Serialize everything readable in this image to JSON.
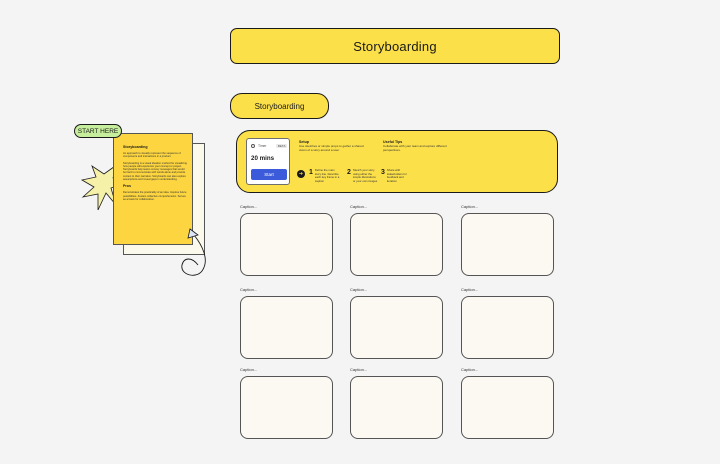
{
  "board": {
    "title": "Storyboarding",
    "section_label": "Storyboarding"
  },
  "instructions": {
    "timer": {
      "label": "Timer",
      "badge": "BETA",
      "duration": "20 mins",
      "start_label": "Start"
    },
    "setup": {
      "title": "Setup",
      "text": "Use sketches or simple props to gather a shared vision of a story around a user"
    },
    "useful_tips": {
      "title": "Useful Tips",
      "text": "Collaborate with your team and explore different perspectives."
    },
    "steps": [
      {
        "num": "1",
        "text": "Define the main story line. Describe each key frame in a caption"
      },
      {
        "num": "2",
        "text": "Sketch your story using either the simple illustrations or your own images"
      },
      {
        "num": "3",
        "text": "Share with stakeholders for feedback and iteration"
      }
    ]
  },
  "sticky": {
    "start_here": "START HERE",
    "heading": "Storyboarding",
    "intro": "An approach to visually represent the sequence of components and interactions in a product.",
    "body": "Storyboarding is a visual ideation method for visualizing how people will experience your concept or project. Storyboards help teams convey messages that would be hard to communicate with words alone and provide context to their narrative. Storyboards can also explore assumptions and reveal gaps in understanding.",
    "pros_heading": "Pros",
    "pros_text": "Demonstrates the practicality of an idea. Inspires future possibilities. Fosters collective comprehension. Serves as a basis for collaboration."
  },
  "frames": [
    {
      "caption": "Caption..."
    },
    {
      "caption": "Caption..."
    },
    {
      "caption": "Caption..."
    },
    {
      "caption": "Caption..."
    },
    {
      "caption": "Caption..."
    },
    {
      "caption": "Caption..."
    },
    {
      "caption": "Caption..."
    },
    {
      "caption": "Caption..."
    },
    {
      "caption": "Caption..."
    }
  ],
  "colors": {
    "background": "#f4f4f5",
    "yellow": "#fce04a",
    "sticky_yellow": "#fcd540",
    "start_here_green": "#c6ee9c",
    "start_button_blue": "#3b5bdb",
    "frame_fill": "#fbf9f2"
  }
}
